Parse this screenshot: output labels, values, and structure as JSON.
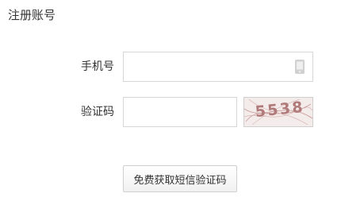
{
  "page": {
    "title": "注册账号"
  },
  "form": {
    "phone": {
      "label": "手机号",
      "value": "",
      "placeholder": "",
      "icon": "phone-icon"
    },
    "captcha": {
      "label": "验证码",
      "value": "",
      "placeholder": "",
      "image_text": "5538",
      "icon": "captcha-image"
    }
  },
  "actions": {
    "sms_button_label": "免费获取短信验证码"
  },
  "colors": {
    "border": "#d6d6d6",
    "captcha_text": "#b07a7a",
    "captcha_bg": "#f4ecea"
  }
}
